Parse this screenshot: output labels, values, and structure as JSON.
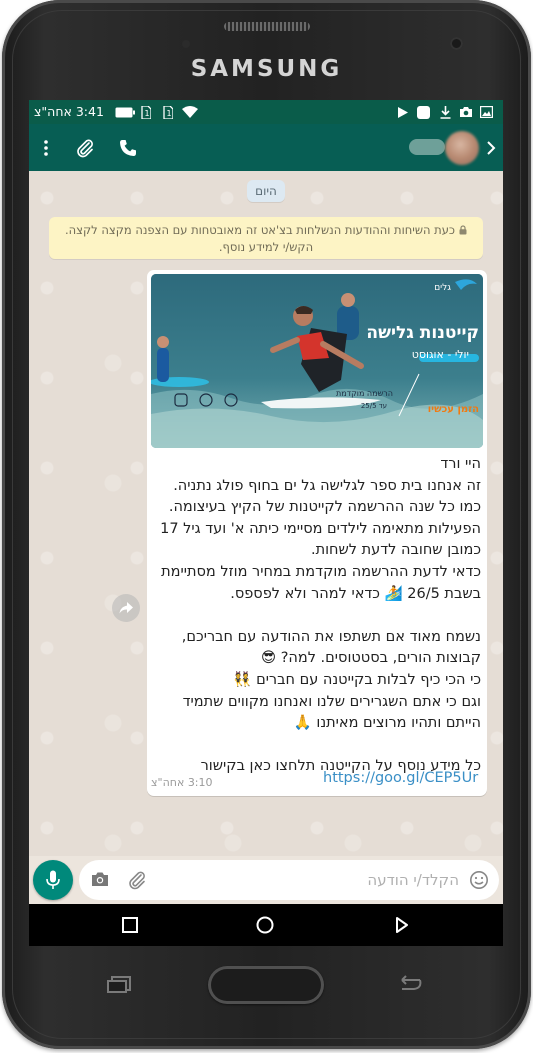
{
  "device": {
    "brand": "SAMSUNG"
  },
  "status_bar": {
    "time": "3:41 אחה\"צ",
    "battery": "battery-icon",
    "signal": "signal-icon",
    "wifi": "wifi-icon"
  },
  "app_bar": {
    "contact": ""
  },
  "chat": {
    "date_chip": "היום",
    "encryption_notice": "כעת השיחות וההודעות הנשלחות בצ'אט זה מאובטחות עם הצפנה מקצה לקצה. הקש/י למידע נוסף.",
    "message": {
      "image": {
        "logo_text": "גלים",
        "title": "קייטנות גלישה",
        "subtitle": "יולי - אוגוסט",
        "registration": "הרשמה מוקדמת",
        "registration_until": "עד 25/5",
        "cta": "הזמן עכשיו"
      },
      "body": "היי ורד\nזה אנחנו בית ספר לגלישה גל ים בחוף פולג נתניה.\nכמו כל שנה ההרשמה לקייטנות של הקיץ בעיצומה.\nהפעילות מתאימה לילדים מסיימי כיתה א' ועד גיל 17 כמובן שחובה לדעת לשחות.\nכדאי לדעת ההרשמה מוקדמת במחיר מוזל מסתיימת בשבת 26/5 🏄 כדאי למהר ולא לפספס.\n\nנשמח מאוד אם תשתפו את ההודעה עם חבריכם, קבוצות הורים, בסטטוסים. למה? 😎\nכי  הכי כיף לבלות בקייטנה עם חברים 👯\nוגם כי אתם השגרירים שלנו ואנחנו מקווים שתמיד הייתם ותהיו מרוצים מאיתנו 🙏\n\nכל מידע נוסף על הקייטנה תלחצו כאן בקישור",
      "link": "https://goo.gl/CEP5Ur",
      "time": "3:10 אחה\"צ"
    }
  },
  "input": {
    "placeholder": "הקלד/י הודעה"
  },
  "colors": {
    "header": "#075e54",
    "status": "#0a5c4a",
    "accent": "#00897b",
    "link": "#3a8fc6"
  }
}
